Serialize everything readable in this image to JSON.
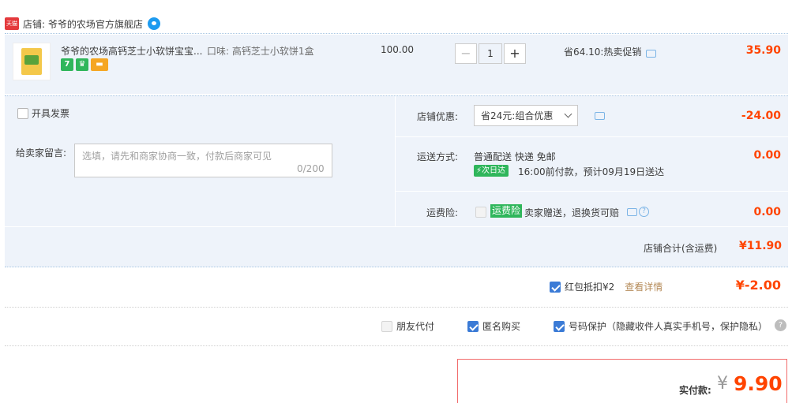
{
  "shop": {
    "badge": "天猫",
    "label": "店铺: 爷爷的农场官方旗舰店"
  },
  "item": {
    "name": "爷爷的农场高钙芝士小软饼宝宝...",
    "sku": "口味: 高钙芝士小软饼1盒",
    "tags": [
      {
        "icon": "seven-day-return-icon",
        "text": "7",
        "color": "#2fb65b"
      },
      {
        "icon": "guarantee-icon",
        "text": "♛",
        "color": "#2fb65b"
      },
      {
        "icon": "card-payment-icon",
        "text": "▬",
        "color": "#f5a623"
      }
    ],
    "price": "100.00",
    "qty": "1",
    "qty_minus": "−",
    "qty_plus": "+",
    "promo": "省64.10:热卖促销",
    "subtotal": "35.90"
  },
  "invoice": {
    "label": "开具发票",
    "checked": false
  },
  "memo": {
    "label": "给卖家留言:",
    "placeholder": "选填，请先和商家协商一致，付款后商家可见",
    "counter": "0/200"
  },
  "shop_discount": {
    "label": "店铺优惠:",
    "selected": "省24元:组合优惠",
    "amount": "-24.00"
  },
  "shipping": {
    "label": "运送方式:",
    "method": "普通配送 快递 免邮",
    "badge": "⚡次日达",
    "time": "16:00前付款，预计09月19日送达",
    "amount": "0.00"
  },
  "insurance": {
    "label": "运费险:",
    "badge": "运费险",
    "text": "卖家赠送，退换货可赔",
    "amount": "0.00"
  },
  "shop_total": {
    "label": "店铺合计(含运费)",
    "amount": "¥11.90"
  },
  "red_packet": {
    "label": "红包抵扣¥2",
    "link": "查看详情",
    "amount": "¥-2.00",
    "checked": true
  },
  "options": [
    {
      "label": "朋友代付",
      "checked": false,
      "disabled": true
    },
    {
      "label": "匿名购买",
      "checked": true,
      "disabled": false
    },
    {
      "label": "号码保护（隐藏收件人真实手机号，保护隐私）",
      "checked": true,
      "disabled": false
    }
  ],
  "pay": {
    "label": "实付款:",
    "currency": "¥",
    "amount": "9.90"
  },
  "colors": {
    "accent": "#ff4400",
    "check": "#3b7bd6",
    "green": "#2fb65b",
    "panel": "#eef3fa"
  }
}
